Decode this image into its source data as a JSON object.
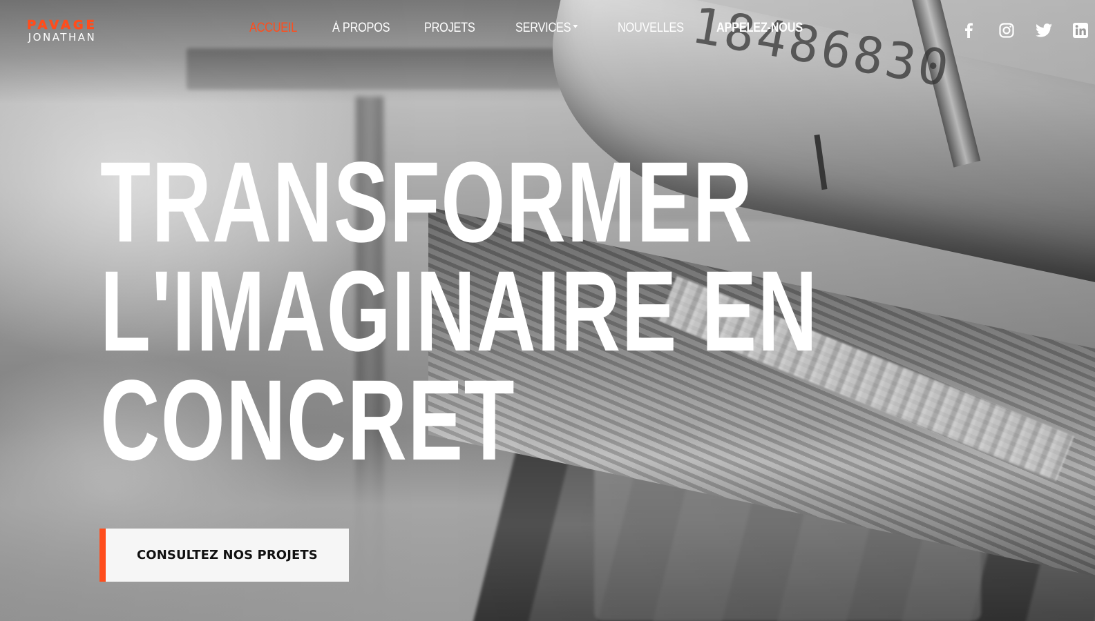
{
  "brand": {
    "logo_top": "PAVAGE",
    "logo_bottom": "JONATHAN",
    "accent_color": "#ff4d1c"
  },
  "nav": {
    "items": [
      {
        "label": "ACCUEIL",
        "active": true
      },
      {
        "label": "À PROPOS"
      },
      {
        "label": "PROJETS"
      },
      {
        "label": "SERVICES",
        "has_dropdown": true
      },
      {
        "label": "NOUVELLES"
      },
      {
        "label": "APPELEZ-NOUS",
        "emphasis": true
      }
    ]
  },
  "social": {
    "icons": [
      "facebook-icon",
      "instagram-icon",
      "twitter-icon",
      "linkedin-icon"
    ]
  },
  "hero": {
    "title_lines": [
      "TRANSFORMER",
      "L'IMAGINAIRE EN",
      "CONCRET"
    ],
    "cta_label": "CONSULTEZ NOS PROJETS",
    "background_stamp": "18486830"
  }
}
